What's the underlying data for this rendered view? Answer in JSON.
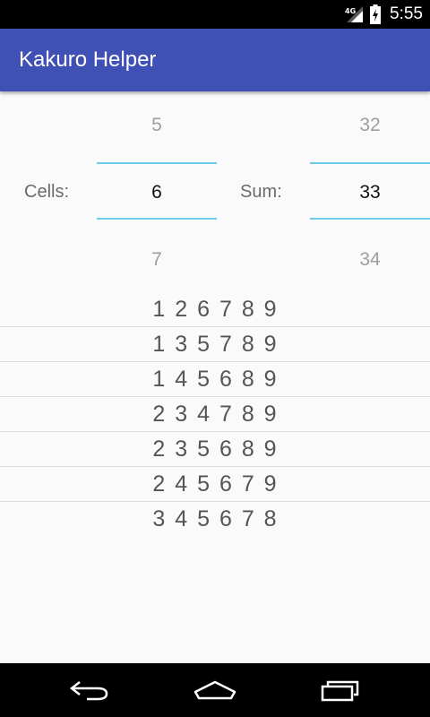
{
  "status_bar": {
    "network": "4G",
    "time": "5:55"
  },
  "app_bar": {
    "title": "Kakuro Helper"
  },
  "pickers": {
    "cells_label": "Cells:",
    "cells": {
      "prev": "5",
      "current": "6",
      "next": "7"
    },
    "sum_label": "Sum:",
    "sum": {
      "prev": "32",
      "current": "33",
      "next": "34"
    }
  },
  "results": [
    "1 2 6 7 8 9",
    "1 3 5 7 8 9",
    "1 4 5 6 8 9",
    "2 3 4 7 8 9",
    "2 3 5 6 8 9",
    "2 4 5 6 7 9",
    "3 4 5 6 7 8"
  ],
  "nav_bar": {
    "back_icon": "back-icon",
    "home_icon": "home-icon",
    "recents_icon": "recents-icon"
  },
  "colors": {
    "primary": "#3f51b5",
    "picker_divider": "#6fcbea",
    "background": "#fafafa"
  }
}
